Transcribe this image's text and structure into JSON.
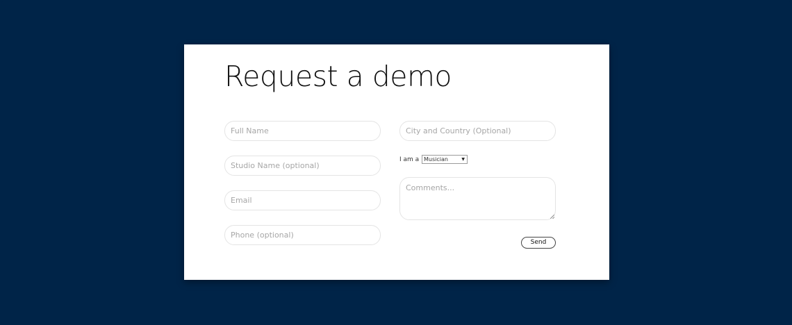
{
  "modal": {
    "title": "Request a demo"
  },
  "form": {
    "full_name": {
      "placeholder": "Full Name",
      "value": ""
    },
    "studio_name": {
      "placeholder": "Studio Name (optional)",
      "value": ""
    },
    "email": {
      "placeholder": "Email",
      "value": ""
    },
    "phone": {
      "placeholder": "Phone (optional)",
      "value": ""
    },
    "city_country": {
      "placeholder": "City and Country (Optional)",
      "value": ""
    },
    "role": {
      "label": "I am a",
      "selected": "Musician"
    },
    "comments": {
      "placeholder": "Comments...",
      "value": ""
    },
    "send_label": "Send"
  },
  "colors": {
    "background": "#002448",
    "modal": "#ffffff",
    "field_border": "#e4e4e4",
    "placeholder": "#a6a6a6"
  }
}
